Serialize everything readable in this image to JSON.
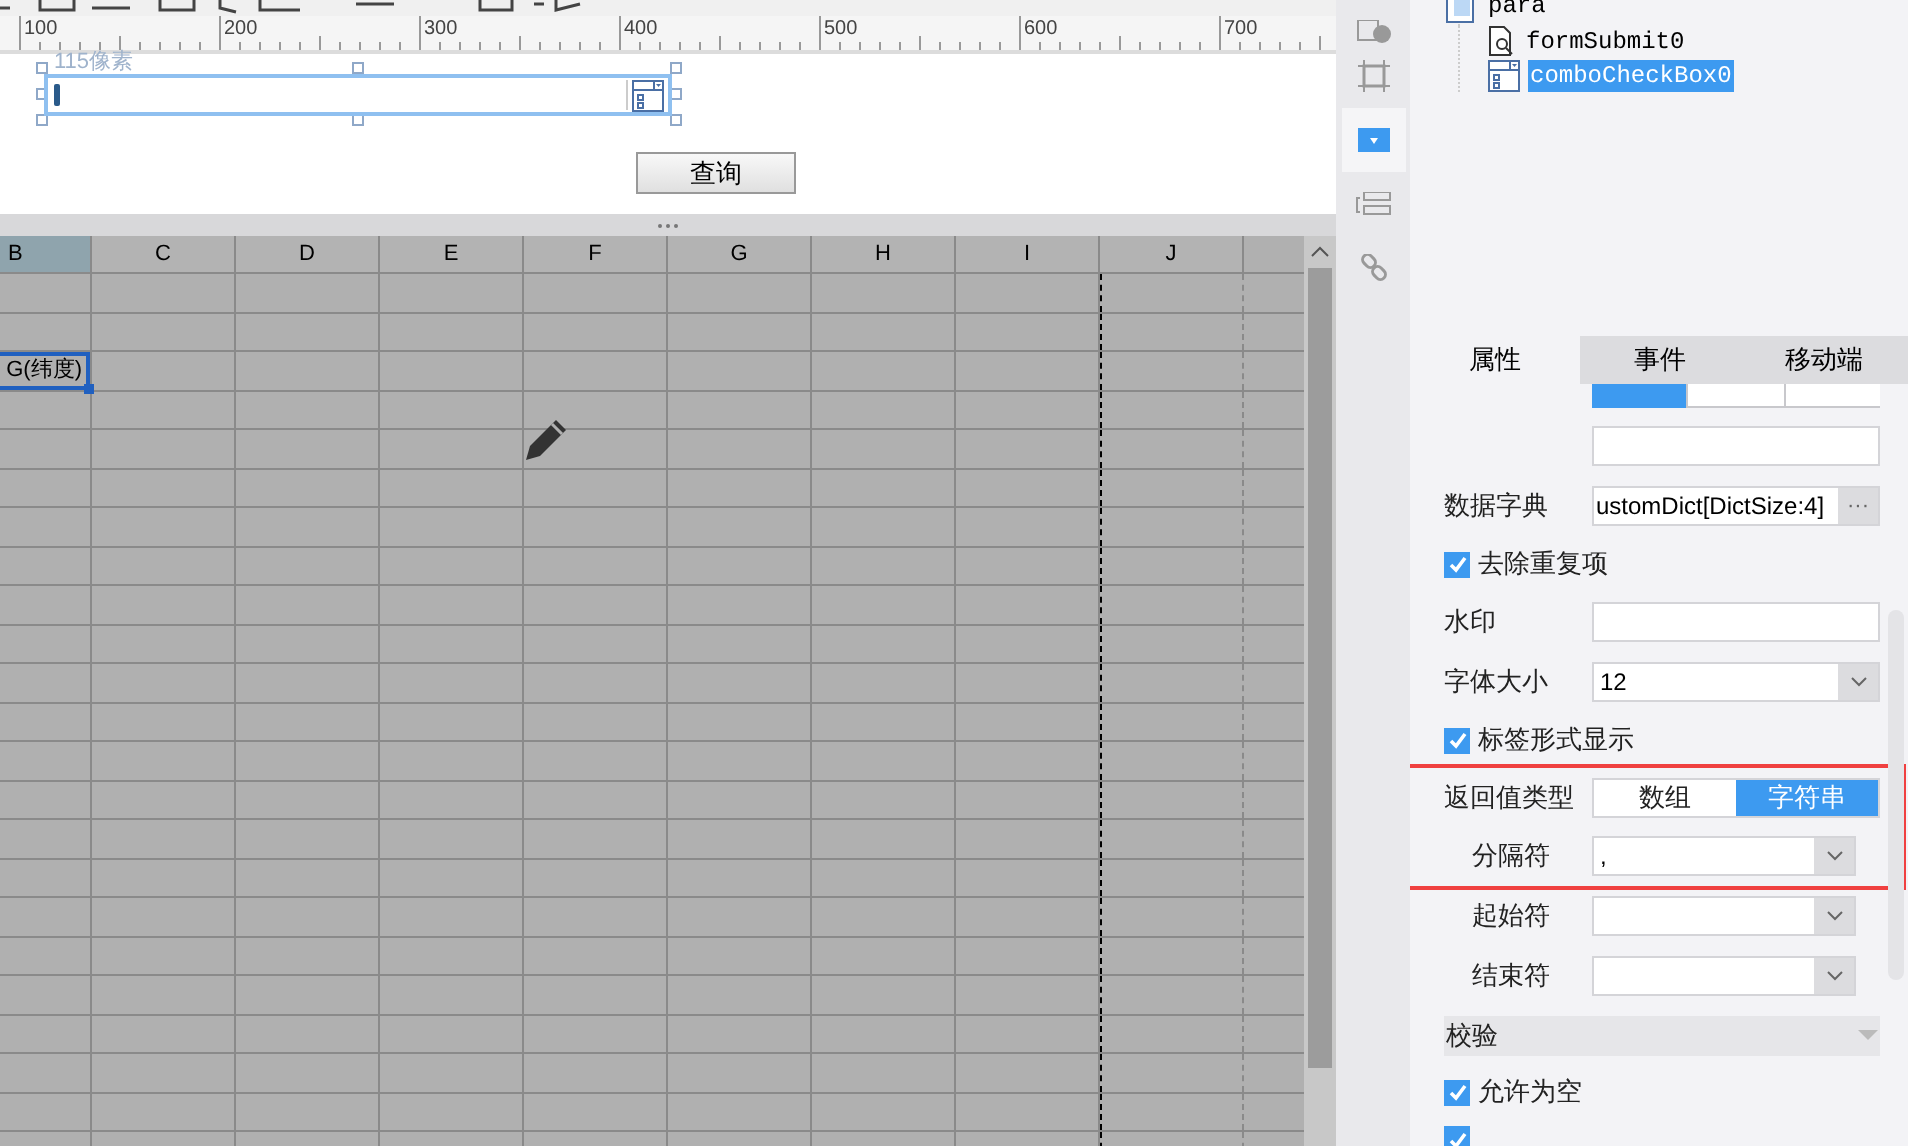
{
  "ruler": {
    "ticks": [
      "100",
      "200",
      "300",
      "400",
      "500",
      "600",
      "700"
    ]
  },
  "form": {
    "size_hint": "115像素",
    "query_button": "查询"
  },
  "grid": {
    "columns": [
      {
        "label": "B",
        "selected": true
      },
      {
        "label": "C",
        "selected": false
      },
      {
        "label": "D",
        "selected": false
      },
      {
        "label": "E",
        "selected": false
      },
      {
        "label": "F",
        "selected": false
      },
      {
        "label": "G",
        "selected": false
      },
      {
        "label": "H",
        "selected": false
      },
      {
        "label": "I",
        "selected": false
      },
      {
        "label": "J",
        "selected": false
      }
    ],
    "selected_cell": {
      "text": "G(纬度)"
    }
  },
  "side_icons": [
    {
      "kind": "info",
      "selected": false
    },
    {
      "kind": "frame",
      "selected": false
    },
    {
      "kind": "dropdown",
      "selected": true
    },
    {
      "kind": "layout",
      "selected": false
    },
    {
      "kind": "link",
      "selected": false
    }
  ],
  "tree": {
    "label": "para",
    "children": [
      {
        "label": "formSubmit0",
        "kind": "submit",
        "selected": false
      },
      {
        "label": "comboCheckBox0",
        "kind": "combo",
        "selected": true
      }
    ]
  },
  "tabs": [
    {
      "label": "属性",
      "selected": true
    },
    {
      "label": "事件",
      "selected": false
    },
    {
      "label": "移动端",
      "selected": false
    }
  ],
  "properties": [
    {
      "kind": "clipped_segments",
      "options": [
        {
          "selected": true
        },
        {
          "selected": false
        },
        {
          "selected": false
        }
      ]
    },
    {
      "kind": "text"
    },
    {
      "kind": "dict",
      "label": "数据字典",
      "value": "ustomDict[DictSize:4]",
      "button": "···"
    },
    {
      "kind": "check",
      "label": "去除重复项",
      "checked": true
    },
    {
      "kind": "text",
      "label": "水印"
    },
    {
      "kind": "select",
      "label": "字体大小",
      "value": "12"
    },
    {
      "kind": "check",
      "label": "标签形式显示",
      "checked": true
    },
    {
      "kind": "group",
      "highlighted": true,
      "items": [
        {
          "kind": "segmented",
          "label": "返回值类型",
          "options": [
            {
              "label": "数组",
              "selected": false
            },
            {
              "label": "字符串",
              "selected": true
            }
          ]
        },
        {
          "kind": "select",
          "label": "分隔符",
          "value": ",",
          "sub": true
        }
      ]
    },
    {
      "kind": "select",
      "label": "起始符",
      "sub": true
    },
    {
      "kind": "select",
      "label": "结束符",
      "sub": true
    },
    {
      "kind": "section",
      "label": "校验"
    },
    {
      "kind": "check",
      "label": "允许为空",
      "checked": true
    },
    {
      "kind": "check_clipped",
      "checked": true
    }
  ]
}
